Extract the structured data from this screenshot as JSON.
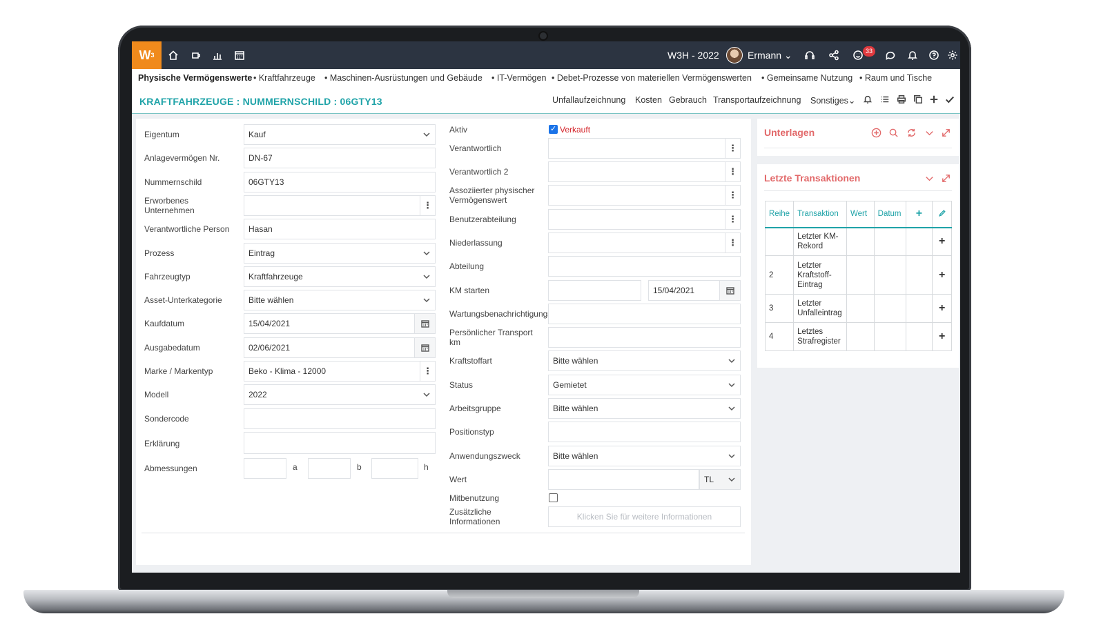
{
  "app": {
    "logo_text": "W",
    "logo_sup": "3",
    "app_name": "W3H - 2022",
    "user_name": "Ermann",
    "notification_count": "33",
    "accent_color": "#1fa3a8",
    "brand_color": "#f08a1c"
  },
  "module_nav": {
    "items": [
      "Physische Vermögenswerte",
      "• Kraftfahrzeuge",
      "• Maschinen-Ausrüstungen und Gebäude",
      "• IT-Vermögen",
      "• Debet-Prozesse von materiellen Vermögenswerten",
      "• Gemeinsame Nutzung",
      "• Raum und Tische"
    ]
  },
  "page": {
    "title": "KRAFTFAHRZEUGE : NUMMERNSCHILD : 06GTY13",
    "tabs": [
      "Unfallaufzeichnung",
      "Kosten",
      "Gebrauch",
      "Transportaufzeichnung",
      "Sonstiges"
    ]
  },
  "form_left": {
    "eigentum": {
      "label": "Eigentum",
      "value": "Kauf"
    },
    "anlage": {
      "label": "Anlagevermögen Nr.",
      "value": "DN-67"
    },
    "nummernschild": {
      "label": "Nummernschild",
      "value": "06GTY13"
    },
    "erworbenes": {
      "label": "Erworbenes Unternehmen",
      "value": ""
    },
    "verantwortliche_person": {
      "label": "Verantwortliche Person",
      "value": "Hasan"
    },
    "prozess": {
      "label": "Prozess",
      "value": "Eintrag"
    },
    "fahrzeugtyp": {
      "label": "Fahrzeugtyp",
      "value": "Kraftfahrzeuge"
    },
    "asset_unterkategorie": {
      "label": "Asset-Unterkategorie",
      "value": "Bitte wählen"
    },
    "kaufdatum": {
      "label": "Kaufdatum",
      "value": "15/04/2021"
    },
    "ausgabedatum": {
      "label": "Ausgabedatum",
      "value": "02/06/2021"
    },
    "marke": {
      "label": "Marke / Markentyp",
      "value": "Beko - Klima - 12000"
    },
    "modell": {
      "label": "Modell",
      "value": "2022"
    },
    "sondercode": {
      "label": "Sondercode",
      "value": ""
    },
    "erklaerung": {
      "label": "Erklärung",
      "value": ""
    },
    "abmessungen": {
      "label": "Abmessungen",
      "units": [
        "a",
        "b",
        "h"
      ]
    }
  },
  "form_right": {
    "aktiv": {
      "label": "Aktiv",
      "checkbox_label": "Verkauft",
      "checked": true
    },
    "verantwortlich": {
      "label": "Verantwortlich"
    },
    "verantwortlich2": {
      "label": "Verantwortlich 2"
    },
    "assoziierter": {
      "label": "Assoziierter physischer Vermögenswert"
    },
    "benutzerabteilung": {
      "label": "Benutzerabteilung"
    },
    "niederlassung": {
      "label": "Niederlassung"
    },
    "abteilung": {
      "label": "Abteilung"
    },
    "km_starten": {
      "label": "KM starten",
      "value": "",
      "date": "15/04/2021"
    },
    "wartung": {
      "label": "Wartungsbenachrichtigungs"
    },
    "persoenlicher": {
      "label": "Persönlicher Transport km"
    },
    "kraftstoffart": {
      "label": "Kraftstoffart",
      "value": "Bitte wählen"
    },
    "status": {
      "label": "Status",
      "value": "Gemietet"
    },
    "arbeitsgruppe": {
      "label": "Arbeitsgruppe",
      "value": "Bitte wählen"
    },
    "positionstyp": {
      "label": "Positionstyp",
      "value": ""
    },
    "anwendungszweck": {
      "label": "Anwendungszweck",
      "value": "Bitte wählen"
    },
    "wert": {
      "label": "Wert",
      "value": "",
      "currency": "TL"
    },
    "mitbenutzung": {
      "label": "Mitbenutzung",
      "checked": false
    },
    "zusaetzliche": {
      "label": "Zusätzliche Informationen",
      "placeholder": "Klicken Sie für weitere Informationen"
    }
  },
  "unterlagen": {
    "title": "Unterlagen"
  },
  "transaktionen": {
    "title": "Letzte Transaktionen",
    "columns": [
      "Reihe",
      "Transaktion",
      "Wert",
      "Datum"
    ],
    "rows": [
      {
        "reihe": "",
        "transaktion": "Letzter KM-Rekord"
      },
      {
        "reihe": "2",
        "transaktion": "Letzter Kraftstoff-Eintrag"
      },
      {
        "reihe": "3",
        "transaktion": "Letzter Unfalleintrag"
      },
      {
        "reihe": "4",
        "transaktion": "Letztes Strafregister"
      }
    ]
  }
}
